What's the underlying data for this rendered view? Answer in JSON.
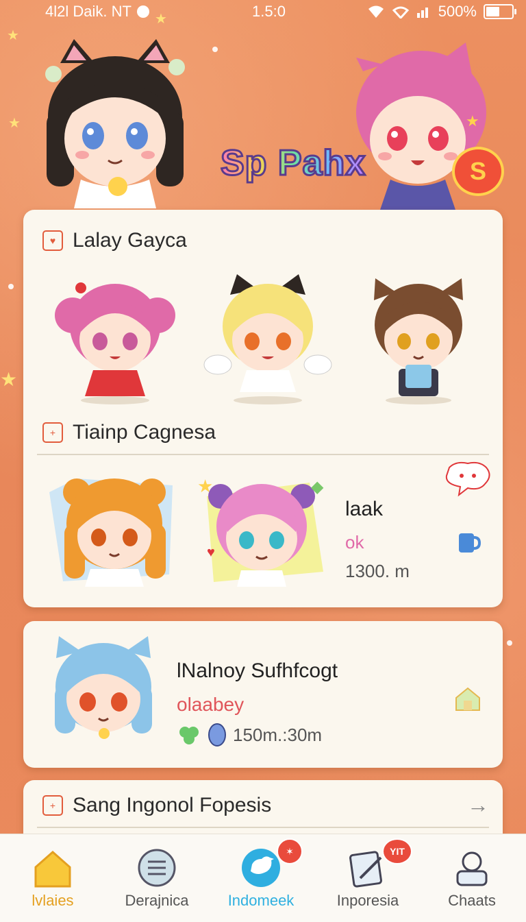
{
  "status_bar": {
    "carrier": "4l2l Daik. NT",
    "time": "1.5:0",
    "battery": "500%",
    "battery_level": 0.6
  },
  "header": {
    "logo_text": "Sp Pahx",
    "logo_badge": "S"
  },
  "section1": {
    "title": "Lalay Gayca"
  },
  "section2": {
    "title": "Tiainp Cagnesa",
    "item": {
      "name": "laak",
      "sub": "ok",
      "value": "1300. m"
    }
  },
  "card2": {
    "name": "lNalnoy Sufhfcogt",
    "sub": "olaabey",
    "value": "150m.:30m"
  },
  "section3": {
    "title": "Sang Ingonol Fopesis"
  },
  "tabs": [
    {
      "label": "lvlaies",
      "icon": "home-icon"
    },
    {
      "label": "Derajnica",
      "icon": "list-icon"
    },
    {
      "label": "Indomeek",
      "icon": "bird-icon"
    },
    {
      "label": "Inporesia",
      "icon": "notes-icon"
    },
    {
      "label": "Chaats",
      "icon": "user-icon"
    }
  ],
  "badges": {
    "tab3": "✶",
    "tab4": "YIT"
  },
  "colors": {
    "background": "#e8895a",
    "card": "#fbf7ee",
    "accent": "#e25c3c",
    "active_tab": "#e4a020",
    "highlight_tab": "#2fb0e0"
  }
}
